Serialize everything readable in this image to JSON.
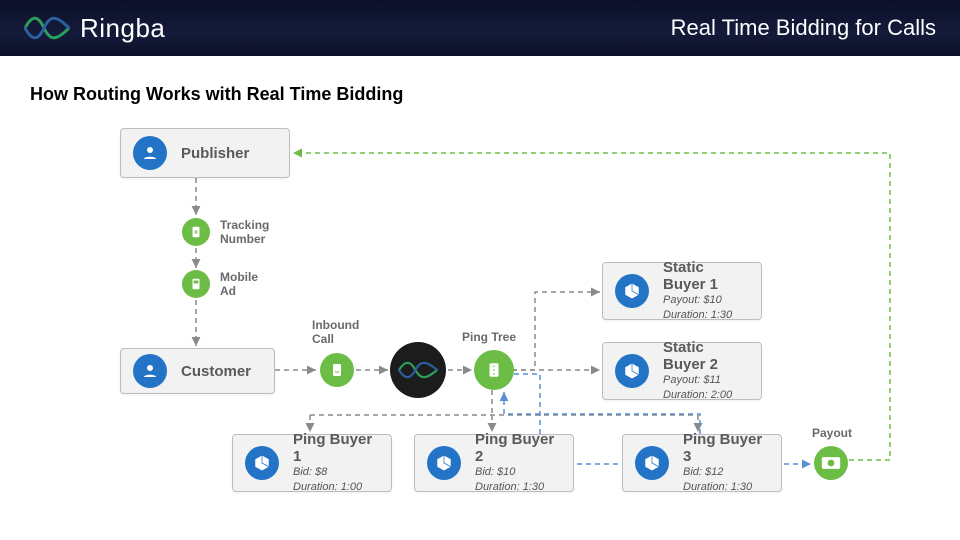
{
  "header": {
    "brand": "Ringba",
    "title": "Real Time Bidding for Calls"
  },
  "section_title": "How Routing Works with Real Time Bidding",
  "nodes": {
    "publisher": {
      "title": "Publisher"
    },
    "customer": {
      "title": "Customer"
    },
    "tracking_number": {
      "label_line1": "Tracking",
      "label_line2": "Number"
    },
    "mobile_ad": {
      "label_line1": "Mobile",
      "label_line2": "Ad"
    },
    "inbound_call": {
      "label_line1": "Inbound",
      "label_line2": "Call"
    },
    "ping_tree": {
      "label": "Ping Tree"
    },
    "payout_label": "Payout",
    "static_buyer_1": {
      "title": "Static Buyer 1",
      "payout": "Payout: $10",
      "duration": "Duration: 1:30"
    },
    "static_buyer_2": {
      "title": "Static Buyer 2",
      "payout": "Payout: $11",
      "duration": "Duration: 2:00"
    },
    "ping_buyer_1": {
      "title": "Ping Buyer 1",
      "bid": "Bid: $8",
      "duration": "Duration: 1:00"
    },
    "ping_buyer_2": {
      "title": "Ping Buyer 2",
      "bid": "Bid: $10",
      "duration": "Duration: 1:30"
    },
    "ping_buyer_3": {
      "title": "Ping Buyer 3",
      "bid": "Bid: $12",
      "duration": "Duration: 1:30"
    }
  },
  "colors": {
    "blue": "#2374c6",
    "green": "#6cbd45",
    "gray_line": "#8a8a8a",
    "blue_line": "#5a8fd6",
    "green_line": "#6cbd45"
  }
}
